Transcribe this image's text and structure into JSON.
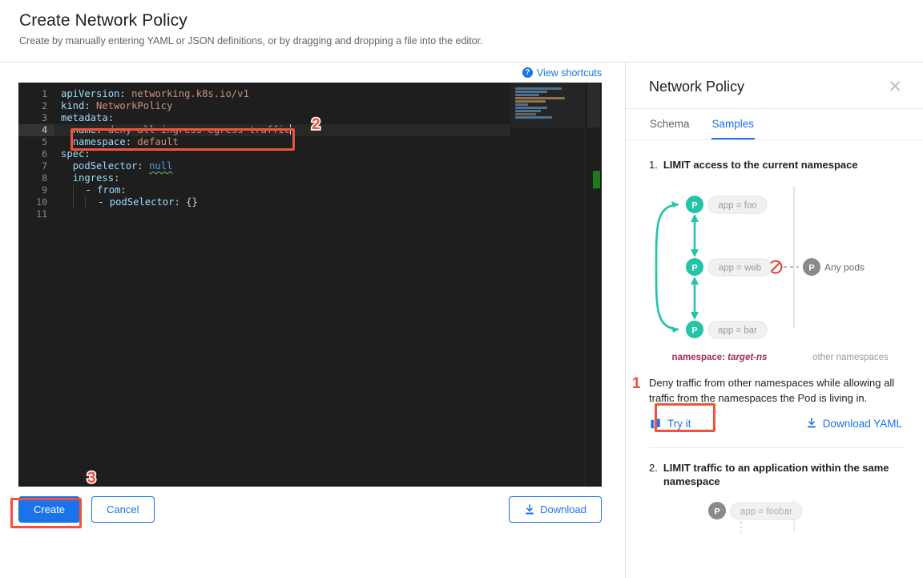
{
  "header": {
    "title": "Create Network Policy",
    "subtitle": "Create by manually entering YAML or JSON definitions, or by dragging and dropping a file into the editor."
  },
  "editor": {
    "shortcuts_label": "View shortcuts",
    "help_icon": "help-icon",
    "line_numbers": [
      "1",
      "2",
      "3",
      "4",
      "5",
      "6",
      "7",
      "8",
      "9",
      "10",
      "11"
    ],
    "active_line": 4,
    "lines": [
      {
        "n": 1,
        "key": "apiVersion",
        "value": "networking.k8s.io/v1",
        "indent": 0
      },
      {
        "n": 2,
        "key": "kind",
        "value": "NetworkPolicy",
        "indent": 0
      },
      {
        "n": 3,
        "key": "metadata",
        "value": "",
        "indent": 0
      },
      {
        "n": 4,
        "key": "name",
        "value": "deny-all-ingress-egress-traffic",
        "indent": 1
      },
      {
        "n": 5,
        "key": "namespace",
        "value": "default",
        "indent": 1
      },
      {
        "n": 6,
        "key": "spec",
        "value": "",
        "indent": 0
      },
      {
        "n": 7,
        "key": "podSelector",
        "value": "null",
        "indent": 1
      },
      {
        "n": 8,
        "key": "ingress",
        "value": "",
        "indent": 1
      },
      {
        "n": 9,
        "key": "- from",
        "value": "",
        "indent": 2
      },
      {
        "n": 10,
        "key": "- podSelector",
        "value": "{}",
        "indent": 3
      },
      {
        "n": 11,
        "key": "",
        "value": "",
        "indent": 0
      }
    ],
    "raw_text": "apiVersion: networking.k8s.io/v1\nkind: NetworkPolicy\nmetadata:\n  name: deny-all-ingress-egress-traffic\n  namespace: default\nspec:\n  podSelector: null\n  ingress:\n    - from:\n        - podSelector: {}\n"
  },
  "footer": {
    "create_label": "Create",
    "cancel_label": "Cancel",
    "download_label": "Download",
    "download_icon": "download-icon"
  },
  "panel": {
    "title": "Network Policy",
    "close_icon": "close-icon",
    "tabs": [
      {
        "label": "Schema",
        "active": false
      },
      {
        "label": "Samples",
        "active": true
      }
    ],
    "samples": [
      {
        "number": "1.",
        "title": "LIMIT access to the current namespace",
        "description": "Deny traffic from other namespaces while allowing all traffic from the namespaces the Pod is living in.",
        "try_label": "Try it",
        "try_icon": "clipboard-icon",
        "download_label": "Download YAML",
        "download_icon": "download-icon",
        "diagram": {
          "pods": [
            {
              "badge": "P",
              "label": "app = foo",
              "color": "#23c4a7"
            },
            {
              "badge": "P",
              "label": "app = web",
              "color": "#23c4a7"
            },
            {
              "badge": "P",
              "label": "app = bar",
              "color": "#23c4a7"
            }
          ],
          "external_pod": {
            "badge": "P",
            "label": "Any pods",
            "color": "#8a8a8a"
          },
          "blocked_icon": "blocked-icon",
          "left_caption": "namespace:",
          "left_caption_value": "target-ns",
          "right_caption": "other namespaces"
        }
      },
      {
        "number": "2.",
        "title": "LIMIT traffic to an application within the same namespace",
        "diagram": {
          "pods": [
            {
              "badge": "P",
              "label": "app = foobar",
              "color": "#8a8a8a"
            }
          ]
        }
      }
    ]
  },
  "annotations": [
    {
      "id": "1",
      "target": "try-it-button"
    },
    {
      "id": "2",
      "target": "editor-line-4"
    },
    {
      "id": "3",
      "target": "create-button"
    }
  ],
  "colors": {
    "accent": "#1a73e8",
    "annotation": "#f4513b",
    "pod_teal": "#23c4a7",
    "pod_gray": "#8a8a8a",
    "namespace_label": "#a3295c"
  }
}
